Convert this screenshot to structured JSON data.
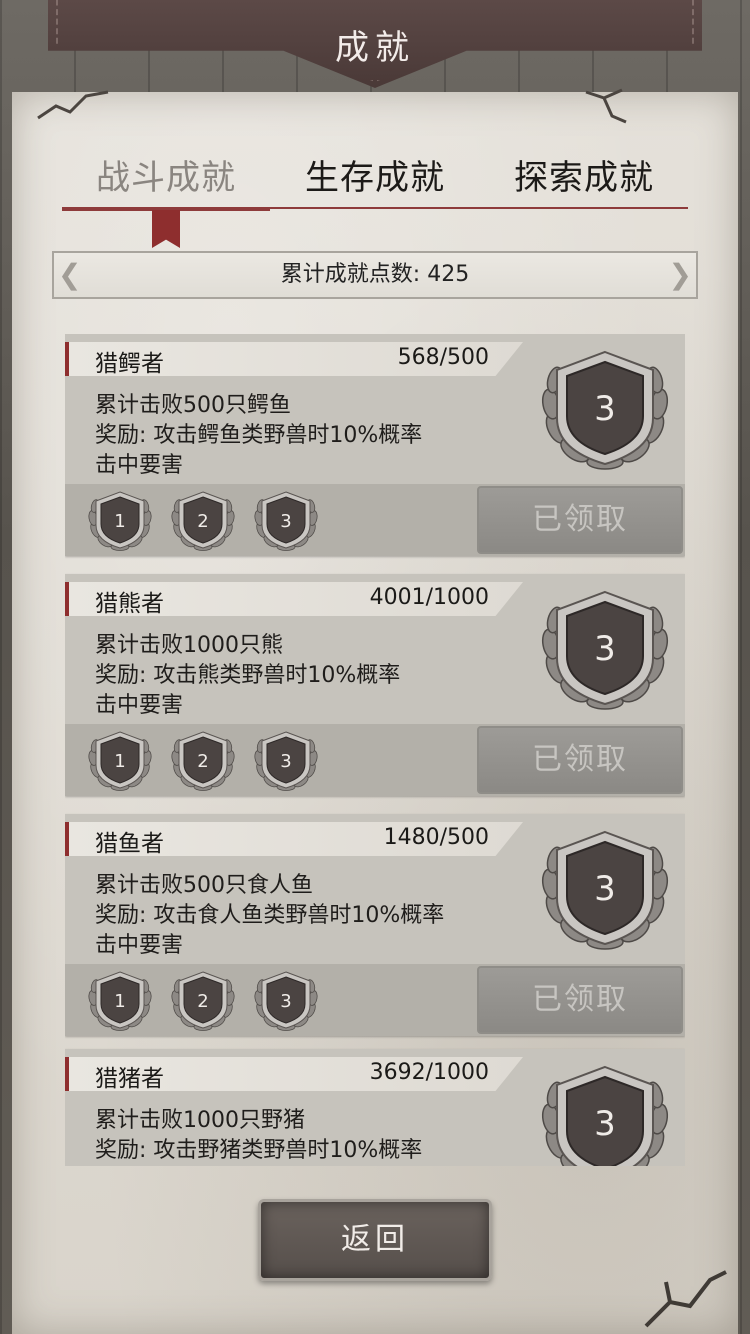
{
  "header": {
    "title": "成就"
  },
  "tabs": [
    {
      "label": "战斗成就",
      "active": true
    },
    {
      "label": "生存成就",
      "active": false
    },
    {
      "label": "探索成就",
      "active": false
    }
  ],
  "points": {
    "text": "累计成就点数: 425"
  },
  "achievements": [
    {
      "name": "猎鳄者",
      "progress": "568/500",
      "desc": "累计击败500只鳄鱼\n奖励: 攻击鳄鱼类野兽时10%概率\n击中要害",
      "level": "3",
      "tiers": [
        "1",
        "2",
        "3"
      ],
      "button": "已领取"
    },
    {
      "name": "猎熊者",
      "progress": "4001/1000",
      "desc": "累计击败1000只熊\n奖励: 攻击熊类野兽时10%概率\n击中要害",
      "level": "3",
      "tiers": [
        "1",
        "2",
        "3"
      ],
      "button": "已领取"
    },
    {
      "name": "猎鱼者",
      "progress": "1480/500",
      "desc": "累计击败500只食人鱼\n奖励: 攻击食人鱼类野兽时10%概率\n击中要害",
      "level": "3",
      "tiers": [
        "1",
        "2",
        "3"
      ],
      "button": "已领取"
    },
    {
      "name": "猎猪者",
      "progress": "3692/1000",
      "desc": "累计击败1000只野猪\n奖励: 攻击野猪类野兽时10%概率",
      "level": "3",
      "tiers": [],
      "button": ""
    }
  ],
  "footer": {
    "return_label": "返回"
  },
  "colors": {
    "accent": "#8e2e2e",
    "medal": "#4b4442",
    "parchment": "#e2ded7"
  },
  "icons": {
    "medal": "laurel-shield-medal-icon",
    "corner": "ornament-corner-icon"
  }
}
